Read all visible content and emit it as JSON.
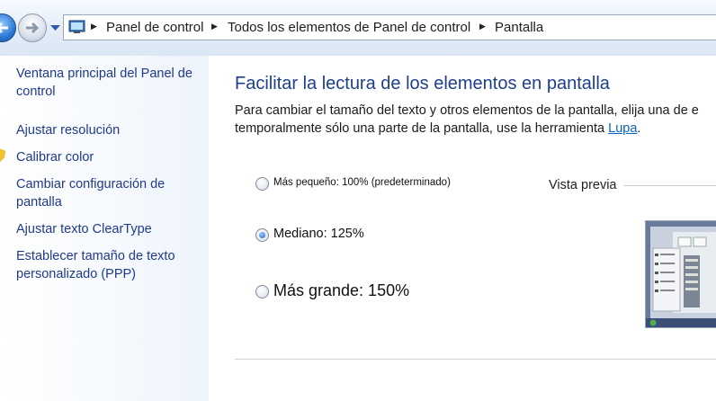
{
  "addressbar": {
    "breadcrumbs": [
      "Panel de control",
      "Todos los elementos de Panel de control",
      "Pantalla"
    ]
  },
  "leftpane": {
    "links": [
      {
        "label": "Ventana principal del Panel de control"
      },
      {
        "label": "Ajustar resolución"
      },
      {
        "label": "Calibrar color"
      },
      {
        "label": "Cambiar configuración de pantalla"
      },
      {
        "label": "Ajustar texto ClearType"
      },
      {
        "label": "Establecer tamaño de texto personalizado (PPP)"
      }
    ]
  },
  "main": {
    "heading": "Facilitar la lectura de los elementos en pantalla",
    "intro_line1": "Para cambiar el tamaño del texto y otros elementos de la pantalla, elija una de e",
    "intro_line2_prefix": "temporalmente sólo una parte de la pantalla, use la herramienta ",
    "intro_link": "Lupa",
    "intro_line2_suffix": ".",
    "options": [
      {
        "label": "Más pequeño: 100% (predeterminado)",
        "checked": false
      },
      {
        "label": "Mediano: 125%",
        "checked": true
      },
      {
        "label": "Más grande: 150%",
        "checked": false
      }
    ],
    "preview_label": "Vista previa"
  },
  "colors": {
    "link": "#1e3a8a",
    "heading": "#1e3f8c",
    "hyperlink": "#0b62c4"
  }
}
